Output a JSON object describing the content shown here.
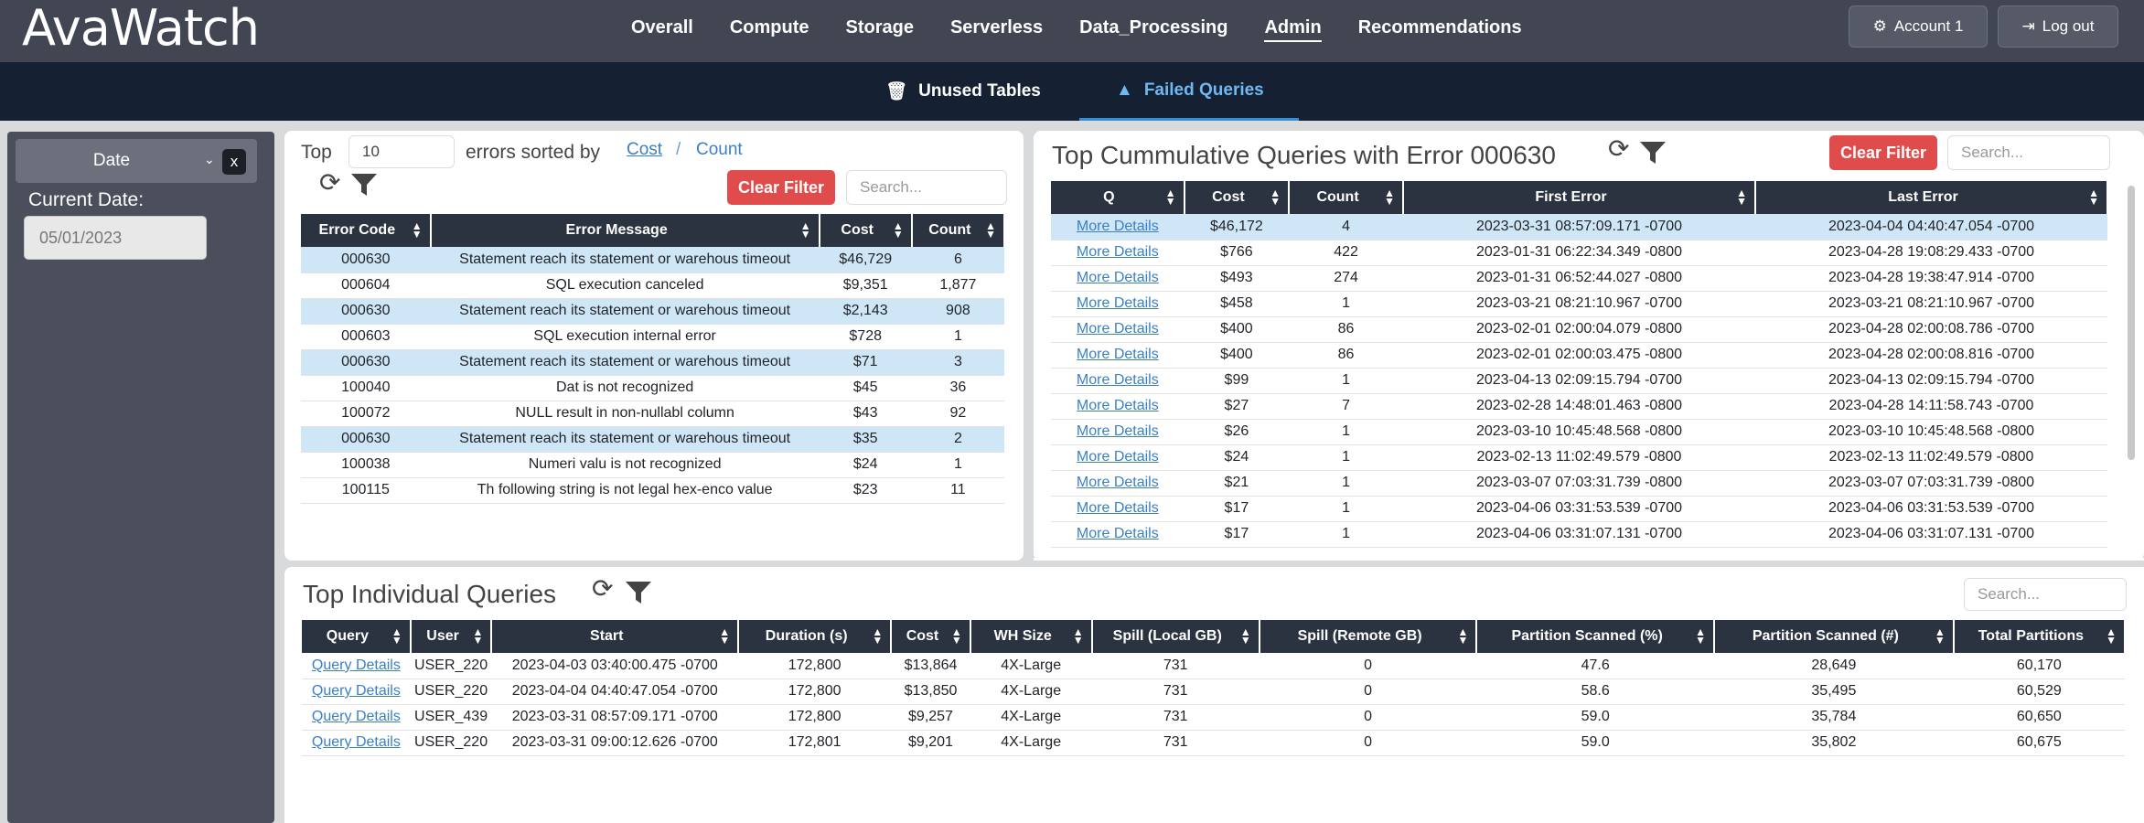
{
  "app": {
    "logo": "AvaWatch"
  },
  "nav": {
    "items": [
      {
        "label": "Overall",
        "active": false
      },
      {
        "label": "Compute",
        "active": false
      },
      {
        "label": "Storage",
        "active": false
      },
      {
        "label": "Serverless",
        "active": false
      },
      {
        "label": "Data_Processing",
        "active": false
      },
      {
        "label": "Admin",
        "active": true
      },
      {
        "label": "Recommendations",
        "active": false
      }
    ]
  },
  "account": {
    "label": "Account 1",
    "logout": "Log out"
  },
  "subtabs": {
    "unused": "Unused Tables",
    "failed": "Failed Queries",
    "active": "Failed Queries"
  },
  "sidebar": {
    "date_select": "Date",
    "clear": "x",
    "current_date_label": "Current Date:",
    "current_date": "05/01/2023"
  },
  "errors_panel": {
    "top_label": "Top",
    "top_n": "10",
    "sorted_by": "errors sorted by",
    "sort_cost": "Cost",
    "sort_sep": "/",
    "sort_count": "Count",
    "clear_filter": "Clear Filter",
    "search_placeholder": "Search...",
    "columns": [
      "Error Code",
      "Error Message",
      "Cost",
      "Count"
    ],
    "rows": [
      {
        "code": "000630",
        "msg": "Statement reach its statement or warehous timeout",
        "cost": "$46,729",
        "count": "6",
        "hl": true
      },
      {
        "code": "000604",
        "msg": "SQL execution canceled",
        "cost": "$9,351",
        "count": "1,877",
        "hl": false
      },
      {
        "code": "000630",
        "msg": "Statement reach its statement or warehous timeout",
        "cost": "$2,143",
        "count": "908",
        "hl": true
      },
      {
        "code": "000603",
        "msg": "SQL execution internal error",
        "cost": "$728",
        "count": "1",
        "hl": false
      },
      {
        "code": "000630",
        "msg": "Statement reach its statement or warehous timeout",
        "cost": "$71",
        "count": "3",
        "hl": true
      },
      {
        "code": "100040",
        "msg": "Dat is not recognized",
        "cost": "$45",
        "count": "36",
        "hl": false
      },
      {
        "code": "100072",
        "msg": "NULL result in non-nullabl column",
        "cost": "$43",
        "count": "92",
        "hl": false
      },
      {
        "code": "000630",
        "msg": "Statement reach its statement or warehous timeout",
        "cost": "$35",
        "count": "2",
        "hl": true
      },
      {
        "code": "100038",
        "msg": "Numeri valu is not recognized",
        "cost": "$24",
        "count": "1",
        "hl": false
      },
      {
        "code": "100115",
        "msg": "Th following string is not legal hex-enco value",
        "cost": "$23",
        "count": "11",
        "hl": false
      }
    ]
  },
  "cumulative_panel": {
    "title": "Top Cummulative Queries with Error 000630",
    "clear_filter": "Clear Filter",
    "search_placeholder": "Search...",
    "columns": [
      "Q",
      "Cost",
      "Count",
      "First Error",
      "Last Error"
    ],
    "link_label": "More Details",
    "rows": [
      {
        "cost": "$46,172",
        "count": "4",
        "first": "2023-03-31 08:57:09.171 -0700",
        "last": "2023-04-04 04:40:47.054 -0700",
        "hl": true
      },
      {
        "cost": "$766",
        "count": "422",
        "first": "2023-01-31 06:22:34.349 -0800",
        "last": "2023-04-28 19:08:29.433 -0700",
        "hl": false
      },
      {
        "cost": "$493",
        "count": "274",
        "first": "2023-01-31 06:52:44.027 -0800",
        "last": "2023-04-28 19:38:47.914 -0700",
        "hl": false
      },
      {
        "cost": "$458",
        "count": "1",
        "first": "2023-03-21 08:21:10.967 -0700",
        "last": "2023-03-21 08:21:10.967 -0700",
        "hl": false
      },
      {
        "cost": "$400",
        "count": "86",
        "first": "2023-02-01 02:00:04.079 -0800",
        "last": "2023-04-28 02:00:08.786 -0700",
        "hl": false
      },
      {
        "cost": "$400",
        "count": "86",
        "first": "2023-02-01 02:00:03.475 -0800",
        "last": "2023-04-28 02:00:08.816 -0700",
        "hl": false
      },
      {
        "cost": "$99",
        "count": "1",
        "first": "2023-04-13 02:09:15.794 -0700",
        "last": "2023-04-13 02:09:15.794 -0700",
        "hl": false
      },
      {
        "cost": "$27",
        "count": "7",
        "first": "2023-02-28 14:48:01.463 -0800",
        "last": "2023-04-28 14:11:58.743 -0700",
        "hl": false
      },
      {
        "cost": "$26",
        "count": "1",
        "first": "2023-03-10 10:45:48.568 -0800",
        "last": "2023-03-10 10:45:48.568 -0800",
        "hl": false
      },
      {
        "cost": "$24",
        "count": "1",
        "first": "2023-02-13 11:02:49.579 -0800",
        "last": "2023-02-13 11:02:49.579 -0800",
        "hl": false
      },
      {
        "cost": "$21",
        "count": "1",
        "first": "2023-03-07 07:03:31.739 -0800",
        "last": "2023-03-07 07:03:31.739 -0800",
        "hl": false
      },
      {
        "cost": "$17",
        "count": "1",
        "first": "2023-04-06 03:31:53.539 -0700",
        "last": "2023-04-06 03:31:53.539 -0700",
        "hl": false
      },
      {
        "cost": "$17",
        "count": "1",
        "first": "2023-04-06 03:31:07.131 -0700",
        "last": "2023-04-06 03:31:07.131 -0700",
        "hl": false
      }
    ]
  },
  "individual_panel": {
    "title": "Top Individual Queries",
    "search_placeholder": "Search...",
    "columns": [
      "Query",
      "User",
      "Start",
      "Duration (s)",
      "Cost",
      "WH Size",
      "Spill (Local GB)",
      "Spill (Remote GB)",
      "Partition Scanned (%)",
      "Partition Scanned (#)",
      "Total Partitions"
    ],
    "link_label": "Query Details",
    "rows": [
      {
        "user": "USER_220",
        "start": "2023-04-03 03:40:00.475 -0700",
        "duration": "172,800",
        "cost": "$13,864",
        "wh": "4X-Large",
        "spill_local": "731",
        "spill_remote": "0",
        "pct": "47.6",
        "num": "28,649",
        "total": "60,170"
      },
      {
        "user": "USER_220",
        "start": "2023-04-04 04:40:47.054 -0700",
        "duration": "172,800",
        "cost": "$13,850",
        "wh": "4X-Large",
        "spill_local": "731",
        "spill_remote": "0",
        "pct": "58.6",
        "num": "35,495",
        "total": "60,529"
      },
      {
        "user": "USER_439",
        "start": "2023-03-31 08:57:09.171 -0700",
        "duration": "172,800",
        "cost": "$9,257",
        "wh": "4X-Large",
        "spill_local": "731",
        "spill_remote": "0",
        "pct": "59.0",
        "num": "35,784",
        "total": "60,650"
      },
      {
        "user": "USER_220",
        "start": "2023-03-31 09:00:12.626 -0700",
        "duration": "172,801",
        "cost": "$9,201",
        "wh": "4X-Large",
        "spill_local": "731",
        "spill_remote": "0",
        "pct": "59.0",
        "num": "35,802",
        "total": "60,675"
      }
    ]
  }
}
